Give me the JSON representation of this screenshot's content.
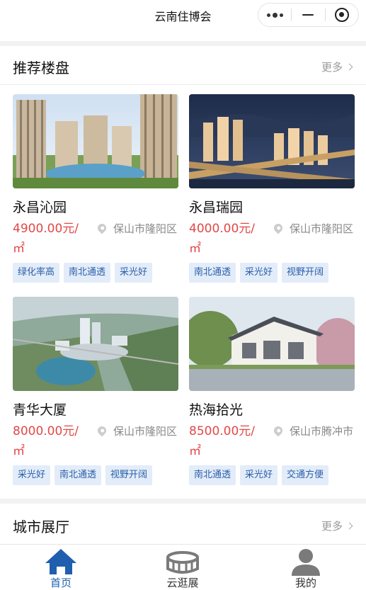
{
  "app": {
    "title": "云南住博会"
  },
  "recommend": {
    "title": "推荐楼盘",
    "more": "更多",
    "listings": [
      {
        "name": "永昌沁园",
        "price": "4900.00元/㎡",
        "location": "保山市隆阳区",
        "tags": [
          "绿化率高",
          "南北通透",
          "采光好"
        ],
        "photo": "apartment-towers-day"
      },
      {
        "name": "永昌瑞园",
        "price": "4000.00元/㎡",
        "location": "保山市隆阳区",
        "tags": [
          "南北通透",
          "采光好",
          "视野开阔"
        ],
        "photo": "apartment-towers-night"
      },
      {
        "name": "青华大厦",
        "price": "8000.00元/㎡",
        "location": "保山市隆阳区",
        "tags": [
          "采光好",
          "南北通透",
          "视野开阔"
        ],
        "photo": "aerial-complex"
      },
      {
        "name": "热海拾光",
        "price": "8500.00元/㎡",
        "location": "保山市腾冲市",
        "tags": [
          "南北通透",
          "采光好",
          "交通方便"
        ],
        "photo": "villa"
      }
    ]
  },
  "city_hall": {
    "title": "城市展厅",
    "more": "更多"
  },
  "tabbar": {
    "items": [
      {
        "label": "首页",
        "icon": "home-icon",
        "active": true
      },
      {
        "label": "云逛展",
        "icon": "stadium-icon",
        "active": false
      },
      {
        "label": "我的",
        "icon": "user-icon",
        "active": false
      }
    ]
  },
  "colors": {
    "accent": "#1f5fae",
    "price": "#e24848",
    "tag_bg": "#e3ecf9",
    "tag_text": "#2a5fa8"
  }
}
